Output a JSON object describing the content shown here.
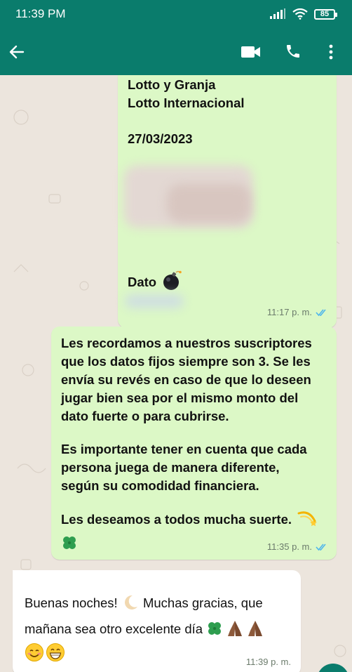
{
  "status_bar": {
    "time": "11:39 PM",
    "battery": "85",
    "icons": [
      "signal-icon",
      "wifi-icon",
      "battery-icon"
    ]
  },
  "app_bar": {
    "icons": [
      "back-arrow-icon",
      "video-call-icon",
      "voice-call-icon",
      "more-options-icon"
    ],
    "color": "#0A7C6C"
  },
  "messages": [
    {
      "direction": "outgoing",
      "lines": [
        "Lotto y Granja",
        "Lotto Internacional",
        "",
        "27/03/2023"
      ],
      "dato_label": "Dato",
      "dato_emoji": "bomb-icon",
      "time": "11:17 p. m.",
      "status": "read"
    },
    {
      "direction": "outgoing",
      "paragraphs": [
        [
          "Les recordamos a nuestros suscriptores",
          "que los datos fijos siempre son 3. Se les",
          "envía su revés en caso de que lo deseen",
          "jugar bien sea por el mismo monto del",
          "dato fuerte o para cubrirse."
        ],
        [
          "Es importante tener en cuenta que cada",
          "persona juega de manera diferente,",
          "según su comodidad financiera."
        ],
        [
          "Les deseamos a todos mucha suerte."
        ]
      ],
      "emojis": [
        "comet-icon",
        "four-leaf-clover-icon"
      ],
      "time": "11:35 p. m.",
      "status": "read"
    },
    {
      "direction": "incoming",
      "lines": [
        "Buenas noches!",
        "Muchas gracias, que",
        "mañana sea otro excelente día"
      ],
      "emojis": [
        "crescent-moon-icon",
        "four-leaf-clover-icon",
        "folded-hands-icon",
        "folded-hands-icon",
        "smiling-face-icon",
        "grinning-face-icon"
      ],
      "time": "11:39 p. m."
    }
  ],
  "colors": {
    "header": "#0A7C6C",
    "outgoing_bubble": "#DCF8C6",
    "incoming_bubble": "#FFFFFF",
    "read_ticks": "#4FB6EC",
    "wallpaper": "#ECE5DD"
  }
}
